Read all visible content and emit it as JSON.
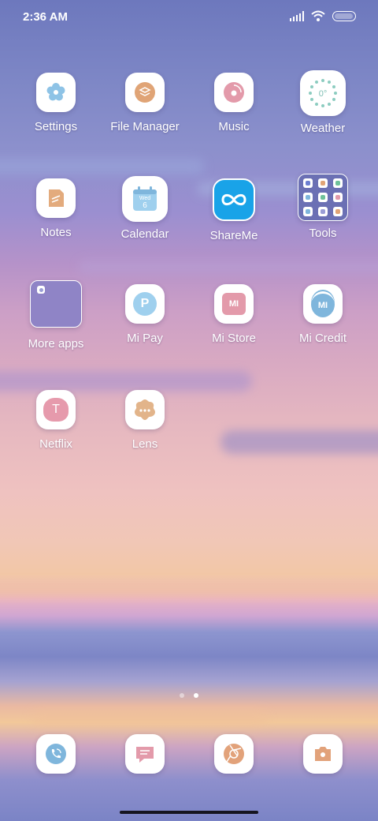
{
  "status_bar": {
    "time": "2:36 AM"
  },
  "apps": [
    {
      "label": "Settings",
      "icon": "settings-icon"
    },
    {
      "label": "File Manager",
      "icon": "file-manager-icon"
    },
    {
      "label": "Music",
      "icon": "music-icon"
    },
    {
      "label": "Weather",
      "icon": "weather-icon",
      "weather_value": "0°"
    },
    {
      "label": "Notes",
      "icon": "notes-icon"
    },
    {
      "label": "Calendar",
      "icon": "calendar-icon",
      "cal_day": "Wed",
      "cal_date": "6"
    },
    {
      "label": "ShareMe",
      "icon": "shareme-icon"
    },
    {
      "label": "Tools",
      "icon": "folder-icon"
    },
    {
      "label": "More apps",
      "icon": "folder-icon"
    },
    {
      "label": "Mi Pay",
      "icon": "mi-pay-icon",
      "glyph": "P"
    },
    {
      "label": "Mi Store",
      "icon": "mi-store-icon",
      "glyph": "MI"
    },
    {
      "label": "Mi Credit",
      "icon": "mi-credit-icon",
      "glyph": "MI"
    },
    {
      "label": "Netflix",
      "icon": "netflix-icon",
      "glyph": "T"
    },
    {
      "label": "Lens",
      "icon": "lens-icon"
    }
  ],
  "dock": [
    {
      "icon": "phone-icon"
    },
    {
      "icon": "messages-icon"
    },
    {
      "icon": "browser-icon"
    },
    {
      "icon": "camera-icon"
    }
  ],
  "page_indicator": {
    "count": 2,
    "active": 2
  },
  "colors": {
    "accent_blue": "#7fb6dc",
    "accent_orange": "#e0a476",
    "accent_pink": "#e39aaa",
    "shareme_blue": "#19a3e8",
    "folder_purple": "#8f84c6"
  }
}
